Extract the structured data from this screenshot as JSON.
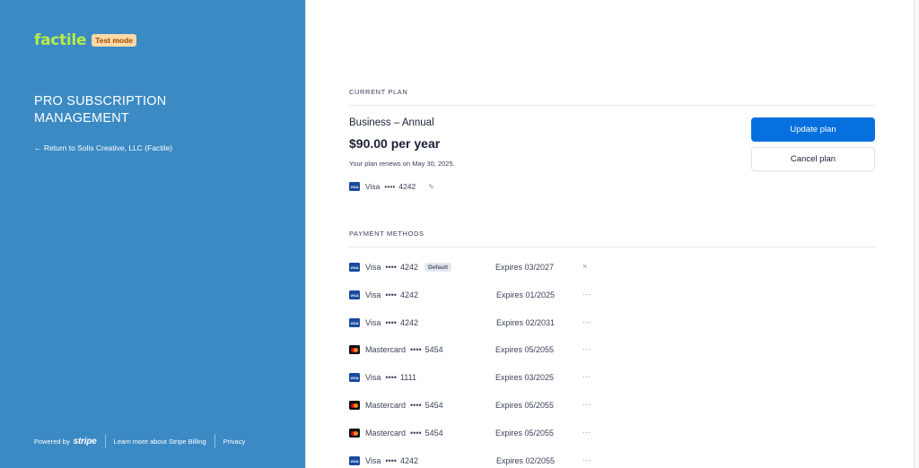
{
  "brand": {
    "logo": "factile",
    "test_badge": "Test mode"
  },
  "sidebar": {
    "heading": "PRO SUBSCRIPTION MANAGEMENT",
    "return_link": "← Return to Solis Creative, LLC (Factile)",
    "footer": {
      "powered_by": "Powered by",
      "stripe": "stripe",
      "learn_more": "Learn more about Stripe Billing",
      "privacy": "Privacy"
    }
  },
  "current_plan": {
    "section_title": "CURRENT PLAN",
    "plan_name": "Business – Annual",
    "price": "$90.00 per year",
    "renews": "Your plan renews on May 30, 2025.",
    "card_brand": "Visa",
    "card_dots": "••••",
    "card_last4": "4242",
    "edit_icon": "pencil-icon",
    "update_label": "Update plan",
    "cancel_label": "Cancel plan"
  },
  "payment_methods": {
    "section_title": "PAYMENT METHODS",
    "dots": "••••",
    "items": [
      {
        "brand": "Visa",
        "last4": "4242",
        "default": "Default",
        "expiry": "Expires 03/2027",
        "action": "×"
      },
      {
        "brand": "Visa",
        "last4": "4242",
        "expiry": "Expires 01/2025",
        "action": "···"
      },
      {
        "brand": "Visa",
        "last4": "4242",
        "expiry": "Expires 02/2031",
        "action": "···"
      },
      {
        "brand": "Mastercard",
        "last4": "5454",
        "expiry": "Expires 05/2055",
        "action": "···"
      },
      {
        "brand": "Visa",
        "last4": "1111",
        "expiry": "Expires 03/2025",
        "action": "···"
      },
      {
        "brand": "Mastercard",
        "last4": "5454",
        "expiry": "Expires 05/2055",
        "action": "···"
      },
      {
        "brand": "Mastercard",
        "last4": "5454",
        "expiry": "Expires 05/2055",
        "action": "···"
      },
      {
        "brand": "Visa",
        "last4": "4242",
        "expiry": "Expires 02/2055",
        "action": "···"
      }
    ]
  },
  "colors": {
    "sidebar_bg": "#3b8ac4",
    "primary_button": "#0570de",
    "logo_green": "#b8ec4a",
    "test_badge_bg": "#ffd9a8"
  }
}
